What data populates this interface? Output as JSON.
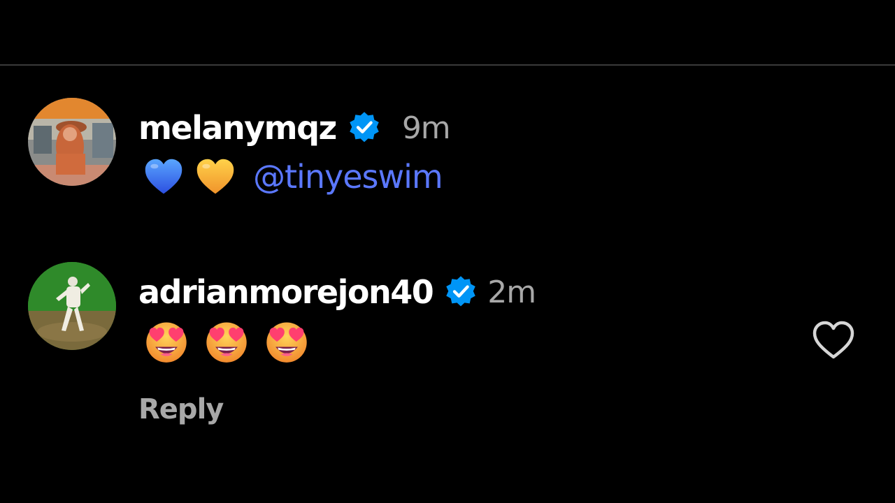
{
  "comments": [
    {
      "username": "melanymqz",
      "verified": true,
      "time": "9m",
      "emojis": [
        "blue-heart",
        "yellow-heart"
      ],
      "mention": "@tinyeswim"
    },
    {
      "username": "adrianmorejon40",
      "verified": true,
      "time": "2m",
      "emojis": [
        "heart-eyes",
        "heart-eyes",
        "heart-eyes"
      ],
      "reply_label": "Reply"
    }
  ],
  "colors": {
    "background": "#000000",
    "text": "#ffffff",
    "muted": "#a8a8a8",
    "mention": "#5b78ff",
    "verified": "#0095f6",
    "divider": "#3a3a3a"
  }
}
